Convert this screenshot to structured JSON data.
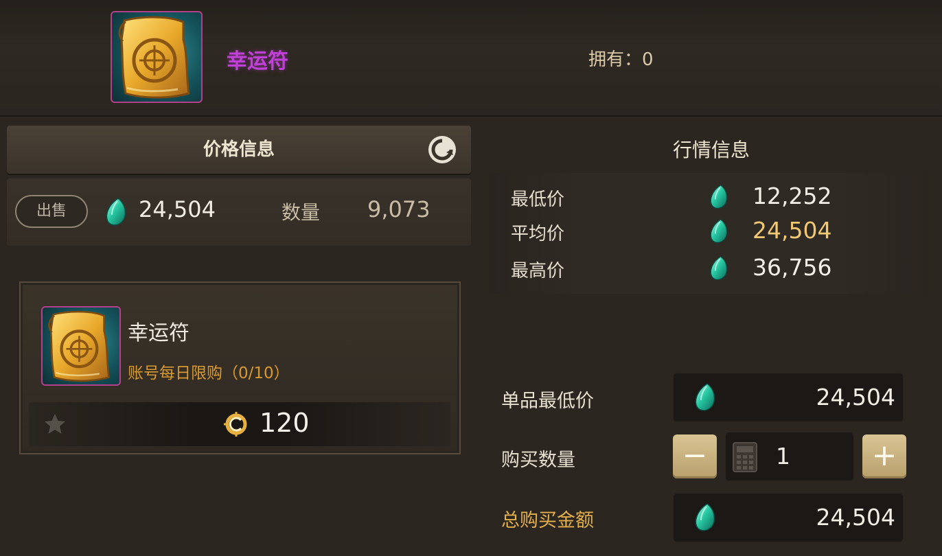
{
  "item": {
    "name": "幸运符",
    "owned_label": "拥有：",
    "owned_count": "0"
  },
  "price_info": {
    "title": "价格信息",
    "sell_button": "出售",
    "sell_price": "24,504",
    "quantity_label": "数量",
    "quantity_value": "9,073"
  },
  "product_card": {
    "name": "幸运符",
    "limit_text": "账号每日限购（0/10）",
    "coin_price": "120"
  },
  "market_info": {
    "title": "行情信息",
    "rows": [
      {
        "label": "最低价",
        "value": "12,252"
      },
      {
        "label": "平均价",
        "value": "24,504"
      },
      {
        "label": "最高价",
        "value": "36,756"
      }
    ]
  },
  "purchase": {
    "unit_min_label": "单品最低价",
    "unit_min_value": "24,504",
    "quantity_label": "购买数量",
    "quantity_value": "1",
    "minus_label": "−",
    "plus_label": "+",
    "total_label": "总购买金额",
    "total_value": "24,504"
  },
  "icons": {
    "currency": "teal-gem-icon",
    "coin": "gold-coin-icon",
    "refresh": "refresh-icon",
    "favorite": "star-icon",
    "calculator": "calculator-icon"
  },
  "colors": {
    "item_name": "#c040d8",
    "limit_text": "#d89a30",
    "avg_price": "#f2c873",
    "total_label": "#e4b04a"
  }
}
